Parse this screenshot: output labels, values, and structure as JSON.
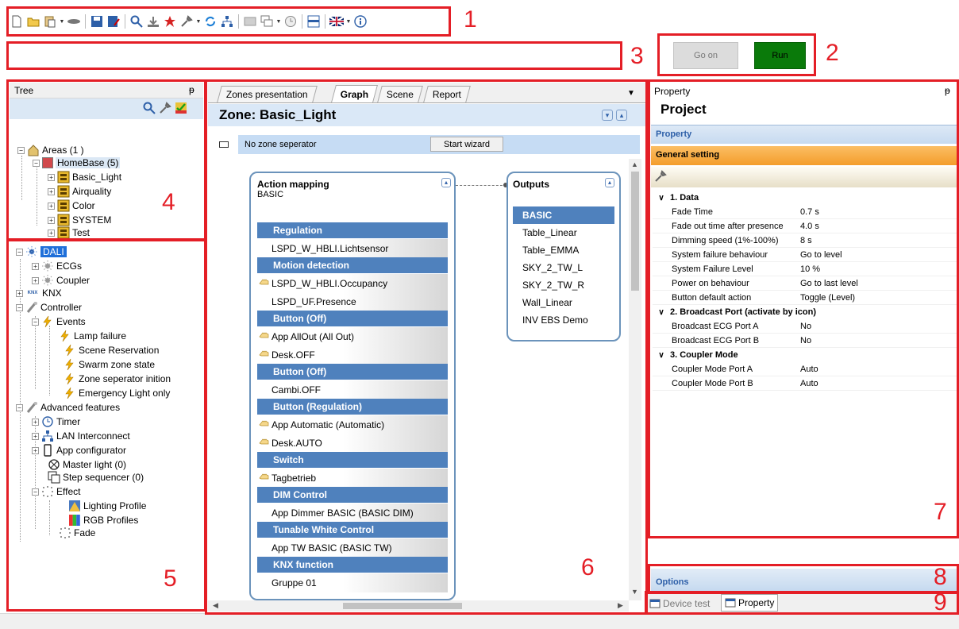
{
  "callouts": [
    "1",
    "2",
    "3",
    "4",
    "5",
    "6",
    "7",
    "8",
    "9"
  ],
  "toolbar": {
    "icons": [
      "new-file-icon",
      "open-folder-icon",
      "paste-icon",
      "device-icon",
      "save-icon",
      "save-as-icon",
      "search-icon",
      "import-icon",
      "star-icon",
      "tools-icon",
      "refresh-icon",
      "network-icon",
      "hide-icon",
      "window-icon",
      "clock-icon",
      "layout-icon",
      "uk-flag-icon",
      "info-icon"
    ]
  },
  "controls": {
    "go_on": "Go on",
    "run": "Run"
  },
  "tree_pane": {
    "title": "Tree",
    "pin": "⍠",
    "items": [
      {
        "label": "Areas (1 )"
      },
      {
        "label": "HomeBase (5)"
      },
      {
        "label": "Basic_Light"
      },
      {
        "label": "Airquality"
      },
      {
        "label": "Color"
      },
      {
        "label": "SYSTEM"
      },
      {
        "label": "Test"
      }
    ]
  },
  "device_tree": {
    "items": [
      {
        "label": "DALI"
      },
      {
        "label": "ECGs"
      },
      {
        "label": "Coupler"
      },
      {
        "label": "KNX"
      },
      {
        "label": "Controller"
      },
      {
        "label": "Events"
      },
      {
        "label": "Lamp failure"
      },
      {
        "label": "Scene Reservation"
      },
      {
        "label": "Swarm zone state"
      },
      {
        "label": "Zone seperator inition"
      },
      {
        "label": "Emergency Light only"
      },
      {
        "label": "Advanced features"
      },
      {
        "label": "Timer"
      },
      {
        "label": "LAN Interconnect"
      },
      {
        "label": "App configurator"
      },
      {
        "label": "Master light (0)"
      },
      {
        "label": "Step sequencer (0)"
      },
      {
        "label": "Effect"
      },
      {
        "label": "Lighting Profile"
      },
      {
        "label": "RGB Profiles"
      },
      {
        "label": "Fade"
      }
    ],
    "knx_badge": "KNX"
  },
  "center": {
    "tabs": [
      "Zones presentation",
      "Graph",
      "Scene",
      "Report"
    ],
    "zone_title": "Zone: Basic_Light",
    "zone_separator": "No zone seperator",
    "start_wizard": "Start wizard",
    "action_mapping": {
      "title": "Action mapping",
      "subtitle": "BASIC",
      "rows": [
        {
          "type": "sec",
          "label": "Regulation"
        },
        {
          "type": "item",
          "label": "LSPD_W_HBLI.Lichtsensor",
          "hand": false
        },
        {
          "type": "sec",
          "label": "Motion detection"
        },
        {
          "type": "item",
          "label": "LSPD_W_HBLI.Occupancy",
          "hand": true
        },
        {
          "type": "item",
          "label": "LSPD_UF.Presence",
          "hand": false
        },
        {
          "type": "sec",
          "label": "Button (Off)"
        },
        {
          "type": "item",
          "label": "App AllOut (All Out)",
          "hand": true
        },
        {
          "type": "item",
          "label": "Desk.OFF",
          "hand": true
        },
        {
          "type": "sec",
          "label": "Button (Off)"
        },
        {
          "type": "item",
          "label": "Cambi.OFF",
          "hand": false
        },
        {
          "type": "sec",
          "label": "Button (Regulation)"
        },
        {
          "type": "item",
          "label": "App Automatic (Automatic)",
          "hand": true
        },
        {
          "type": "item",
          "label": "Desk.AUTO",
          "hand": true
        },
        {
          "type": "sec",
          "label": "Switch"
        },
        {
          "type": "item",
          "label": "Tagbetrieb",
          "hand": true
        },
        {
          "type": "sec",
          "label": "DIM Control"
        },
        {
          "type": "item",
          "label": "App Dimmer BASIC (BASIC DIM)",
          "hand": false
        },
        {
          "type": "sec",
          "label": "Tunable White Control"
        },
        {
          "type": "item",
          "label": "App TW BASIC (BASIC TW)",
          "hand": false
        },
        {
          "type": "sec",
          "label": "KNX function"
        },
        {
          "type": "item",
          "label": "Gruppe 01",
          "hand": false
        }
      ]
    },
    "outputs": {
      "title": "Outputs",
      "items": [
        "BASIC",
        "Table_Linear",
        "Table_EMMA",
        "SKY_2_TW_L",
        "SKY_2_TW_R",
        "Wall_Linear",
        "INV EBS Demo"
      ]
    }
  },
  "property_pane": {
    "title": "Property",
    "project": "Project",
    "property_bar": "Property",
    "general_setting": "General setting",
    "categories": [
      {
        "name": "1. Data",
        "rows": [
          {
            "name": "Fade Time",
            "value": "0.7 s"
          },
          {
            "name": "Fade out time after presence",
            "value": "4.0 s"
          },
          {
            "name": "Dimming speed (1%-100%)",
            "value": "8 s"
          },
          {
            "name": "System failure behaviour",
            "value": "Go to level"
          },
          {
            "name": "System Failure Level",
            "value": "10 %"
          },
          {
            "name": "Power on behaviour",
            "value": "Go to last level"
          },
          {
            "name": "Button default action",
            "value": "Toggle (Level)"
          }
        ]
      },
      {
        "name": "2. Broadcast Port (activate by icon)",
        "rows": [
          {
            "name": "Broadcast ECG Port A",
            "value": "No"
          },
          {
            "name": "Broadcast ECG Port B",
            "value": "No"
          }
        ]
      },
      {
        "name": "3. Coupler Mode",
        "rows": [
          {
            "name": "Coupler Mode Port A",
            "value": "Auto"
          },
          {
            "name": "Coupler Mode Port B",
            "value": "Auto"
          }
        ]
      }
    ],
    "options": "Options",
    "bottom_tabs": [
      "Device test",
      "Property"
    ]
  },
  "colors": {
    "callout_red": "#e41e26",
    "run_green": "#0a7a0a",
    "section_blue": "#4f81bd",
    "zone_header": "#dae8f7",
    "general_orange": "#f7a43c"
  }
}
